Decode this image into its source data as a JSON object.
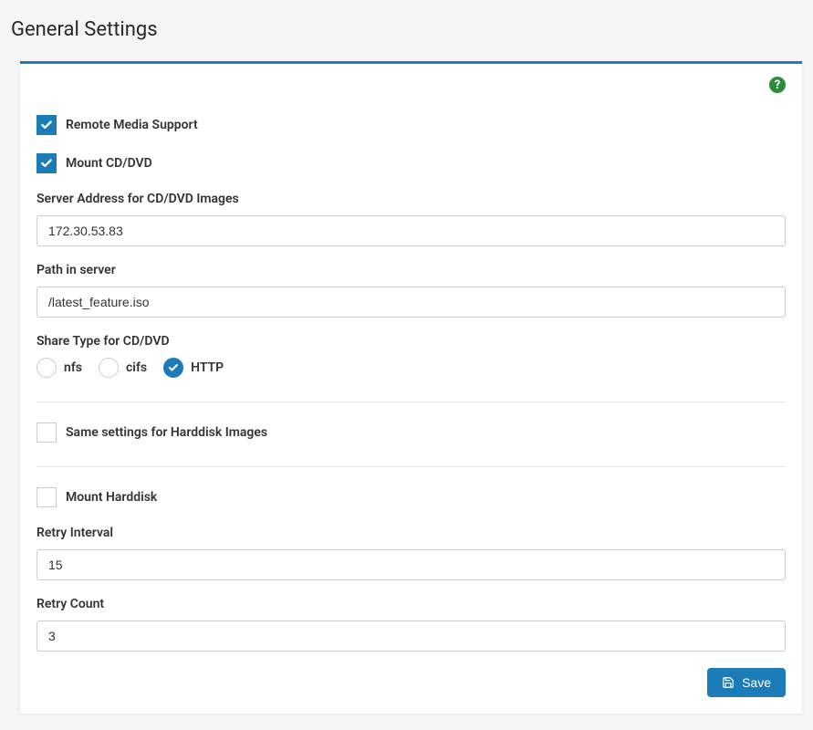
{
  "page": {
    "title": "General Settings"
  },
  "help": {
    "glyph": "?"
  },
  "form": {
    "remote_media_support": {
      "label": "Remote Media Support",
      "checked": true
    },
    "mount_cd_dvd": {
      "label": "Mount CD/DVD",
      "checked": true
    },
    "server_address": {
      "label": "Server Address for CD/DVD Images",
      "value": "172.30.53.83"
    },
    "path_in_server": {
      "label": "Path in server",
      "value": "/latest_feature.iso"
    },
    "share_type": {
      "label": "Share Type for CD/DVD",
      "options": {
        "nfs": "nfs",
        "cifs": "cifs",
        "http": "HTTP"
      },
      "selected": "http"
    },
    "same_settings_harddisk": {
      "label": "Same settings for Harddisk Images",
      "checked": false
    },
    "mount_harddisk": {
      "label": "Mount Harddisk",
      "checked": false
    },
    "retry_interval": {
      "label": "Retry Interval",
      "value": "15"
    },
    "retry_count": {
      "label": "Retry Count",
      "value": "3"
    },
    "save_button": {
      "label": "Save"
    }
  }
}
